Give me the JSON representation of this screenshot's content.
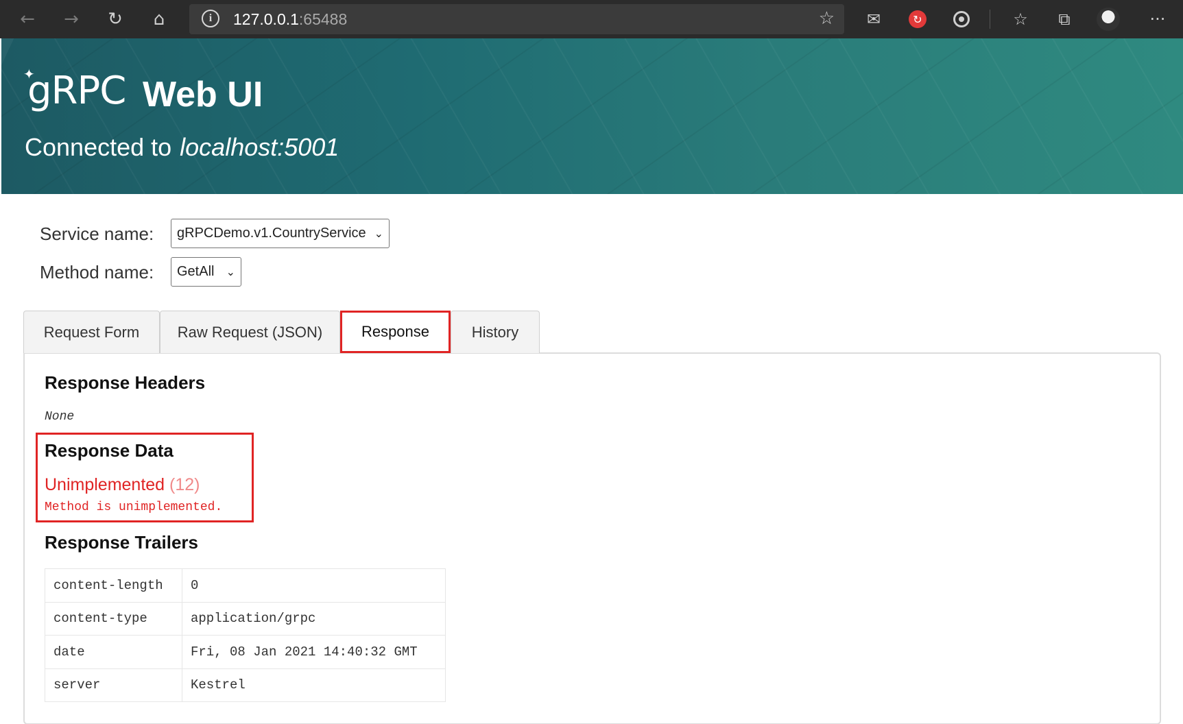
{
  "browser": {
    "url_host": "127.0.0.1",
    "url_port": ":65488",
    "icons": [
      "back-icon",
      "forward-icon",
      "refresh-icon",
      "home-icon",
      "info-icon",
      "favorite-star-icon",
      "mail-icon",
      "extension-red-icon",
      "target-icon",
      "favorites-icon",
      "collections-icon",
      "profile-avatar",
      "more-icon"
    ]
  },
  "banner": {
    "logo": "gRPC",
    "title": "Web UI",
    "connected_label": "Connected to",
    "host": "localhost:5001"
  },
  "form": {
    "service_label": "Service name:",
    "service_value": "gRPCDemo.v1.CountryService",
    "method_label": "Method name:",
    "method_value": "GetAll"
  },
  "tabs": [
    {
      "label": "Request Form"
    },
    {
      "label": "Raw Request (JSON)"
    },
    {
      "label": "Response"
    },
    {
      "label": "History"
    }
  ],
  "response": {
    "headers_title": "Response Headers",
    "headers_value": "None",
    "data_title": "Response Data",
    "status_text": "Unimplemented",
    "status_code": "(12)",
    "message": "Method is unimplemented.",
    "trailers_title": "Response Trailers",
    "trailers": [
      {
        "key": "content-length",
        "value": "0"
      },
      {
        "key": "content-type",
        "value": "application/grpc"
      },
      {
        "key": "date",
        "value": "Fri, 08 Jan 2021 14:40:32 GMT"
      },
      {
        "key": "server",
        "value": "Kestrel"
      }
    ]
  },
  "colors": {
    "error": "#e02424",
    "highlight_border": "#e02424",
    "banner": "#1f6b72"
  }
}
